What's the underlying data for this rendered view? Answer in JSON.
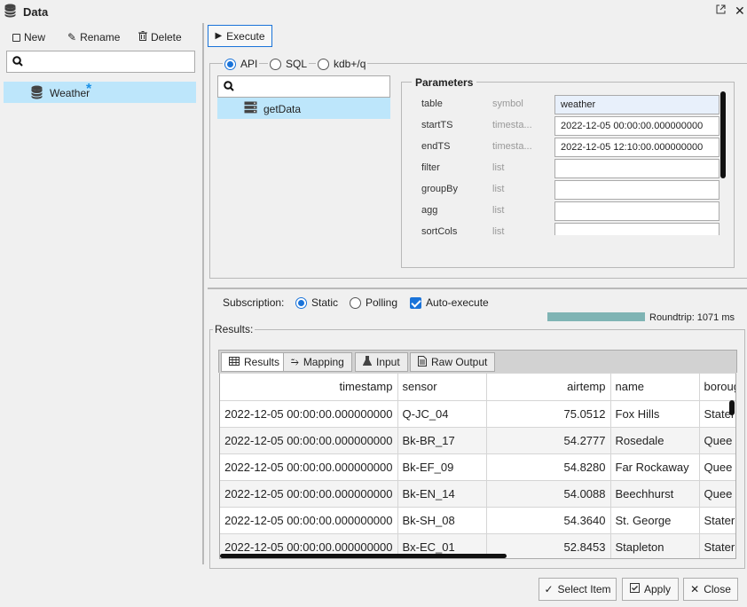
{
  "window": {
    "title": "Data"
  },
  "left": {
    "new_label": "New",
    "rename_label": "Rename",
    "delete_label": "Delete",
    "search_value": "",
    "items": [
      {
        "label": "Weather",
        "modified_mark": "*"
      }
    ]
  },
  "toolbar": {
    "execute_label": "Execute"
  },
  "query": {
    "modes": [
      {
        "label": "API",
        "selected": true
      },
      {
        "label": "SQL",
        "selected": false
      },
      {
        "label": "kdb+/q",
        "selected": false
      }
    ],
    "api_search_value": "",
    "apis": [
      {
        "label": "getData"
      }
    ]
  },
  "parameters": {
    "legend": "Parameters",
    "rows": [
      {
        "name": "table",
        "type": "symbol",
        "value": "weather"
      },
      {
        "name": "startTS",
        "type": "timesta...",
        "value": "2022-12-05 00:00:00.000000000"
      },
      {
        "name": "endTS",
        "type": "timesta...",
        "value": "2022-12-05 12:10:00.000000000"
      },
      {
        "name": "filter",
        "type": "list",
        "value": ""
      },
      {
        "name": "groupBy",
        "type": "list",
        "value": ""
      },
      {
        "name": "agg",
        "type": "list",
        "value": ""
      },
      {
        "name": "sortCols",
        "type": "list",
        "value": ""
      }
    ]
  },
  "subscription": {
    "label": "Subscription:",
    "static_label": "Static",
    "polling_label": "Polling",
    "auto_execute_label": "Auto-execute",
    "roundtrip": "Roundtrip: 1071 ms"
  },
  "results": {
    "legend": "Results:",
    "tabs": [
      "Results",
      "Mapping",
      "Input",
      "Raw Output"
    ],
    "columns": [
      "timestamp",
      "sensor",
      "airtemp",
      "name",
      "boroug"
    ],
    "rows": [
      [
        "2022-12-05 00:00:00.000000000",
        "Q-JC_04",
        "75.0512",
        "Fox Hills",
        "Stater"
      ],
      [
        "2022-12-05 00:00:00.000000000",
        "Bk-BR_17",
        "54.2777",
        "Rosedale",
        "Quee"
      ],
      [
        "2022-12-05 00:00:00.000000000",
        "Bk-EF_09",
        "54.8280",
        "Far Rockaway",
        "Quee"
      ],
      [
        "2022-12-05 00:00:00.000000000",
        "Bk-EN_14",
        "54.0088",
        "Beechhurst",
        "Quee"
      ],
      [
        "2022-12-05 00:00:00.000000000",
        "Bk-SH_08",
        "54.3640",
        "St. George",
        "Stater"
      ],
      [
        "2022-12-05 00:00:00.000000000",
        "Bx-EC_01",
        "52.8453",
        "Stapleton",
        "Stater"
      ]
    ]
  },
  "footer": {
    "select_label": "Select Item",
    "apply_label": "Apply",
    "close_label": "Close"
  }
}
